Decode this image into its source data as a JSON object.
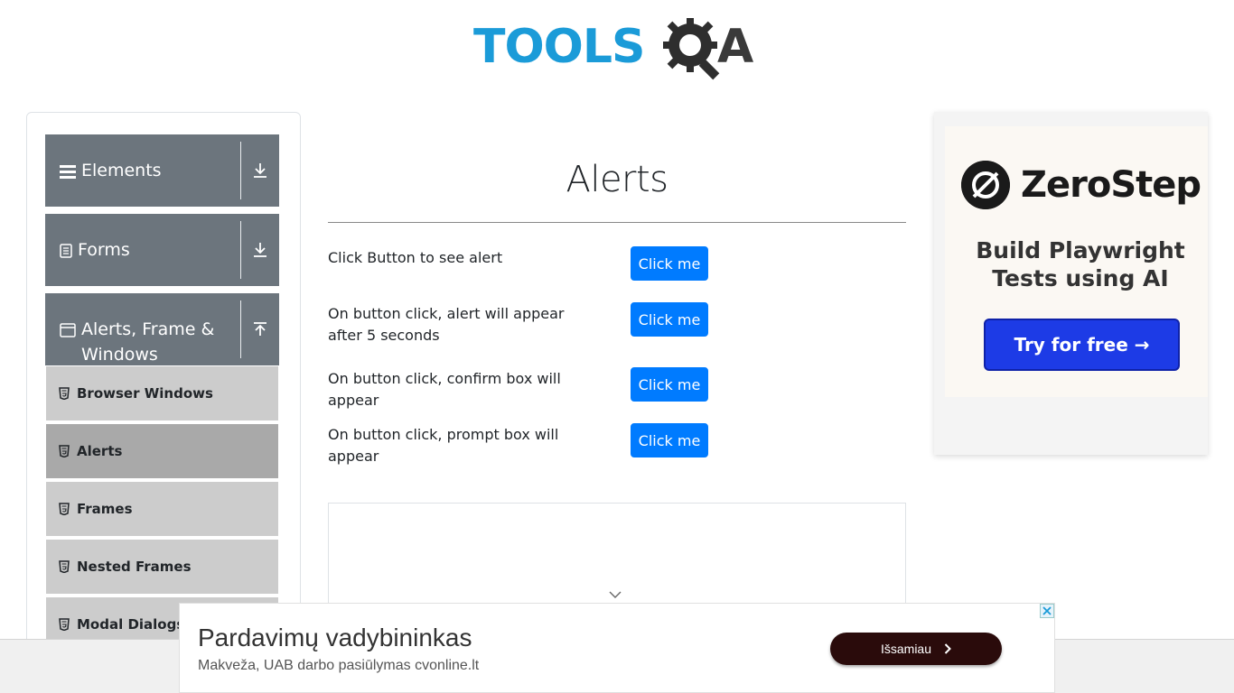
{
  "header": {
    "logo_text_main": "TOOLS",
    "logo_text_end": "A"
  },
  "sidebar": {
    "groups": [
      {
        "label": "Elements",
        "icon": "hamburger-icon",
        "toggle": "download-arrow-icon"
      },
      {
        "label": "Forms",
        "icon": "document-icon",
        "toggle": "download-arrow-icon"
      },
      {
        "label": "Alerts, Frame &",
        "label_line2": "Windows",
        "icon": "window-icon",
        "toggle": "upload-arrow-icon"
      }
    ],
    "items": [
      {
        "label": "Browser Windows",
        "active": false
      },
      {
        "label": "Alerts",
        "active": true
      },
      {
        "label": "Frames",
        "active": false
      },
      {
        "label": "Nested Frames",
        "active": false
      },
      {
        "label": "Modal Dialogs",
        "active": false
      }
    ]
  },
  "main": {
    "title": "Alerts",
    "rows": [
      {
        "label": "Click Button to see alert",
        "button": "Click me"
      },
      {
        "label": "On button click, alert will appear after 5 seconds",
        "button": "Click me"
      },
      {
        "label": "On button click, confirm box will appear",
        "button": "Click me"
      },
      {
        "label": "On button click, prompt box will appear",
        "button": "Click me"
      }
    ]
  },
  "right_ad": {
    "brand": "ZeroStep",
    "tagline_line1": "Build Playwright",
    "tagline_line2": "Tests using AI",
    "cta": "Try for free →"
  },
  "bottom_ad": {
    "title": "Pardavimų vadybininkas",
    "subtitle": "Makveža, UAB darbo pasiūlymas cvonline.lt",
    "cta": "Išsamiau"
  },
  "colors": {
    "primary_button": "#007bff",
    "sidebar_group": "#6c757d",
    "sidebar_item": "#cccccc",
    "sidebar_item_active": "#a9a9a9",
    "logo_blue": "#1b9bd8"
  }
}
